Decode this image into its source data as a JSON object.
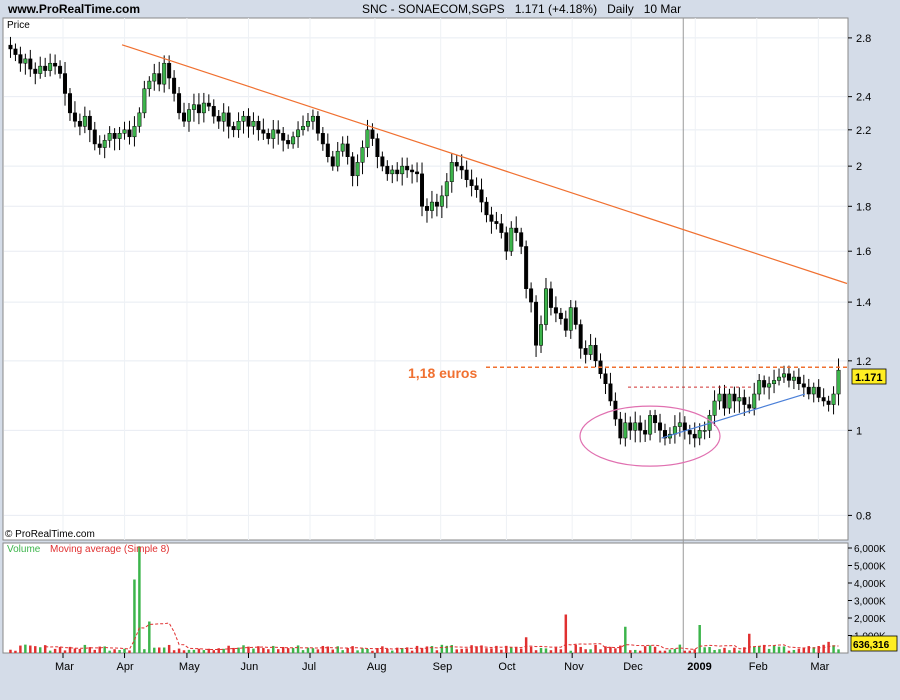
{
  "header": {
    "site": "www.ProRealTime.com",
    "symbol": "SNC - SONAECOM,SGPS",
    "last": "1.171 (+4.18%)",
    "period": "Daily",
    "date": "10 Mar"
  },
  "price_panel": {
    "label": "Price",
    "copyright": "© ProRealTime.com",
    "annotation": "1,18 euros",
    "last_price_tag": "1.171"
  },
  "volume_panel": {
    "label_volume": "Volume",
    "label_ma": "Moving average (Simple 8)",
    "last_volume_tag": "636,316"
  },
  "colors": {
    "background": "#d4dce8",
    "plot": "#ffffff",
    "up_candle": "#3cb44b",
    "down_candle": "#000000",
    "trendline_down": "#f07030",
    "trendline_up": "#4a7fd8",
    "resistance": "#f07030",
    "ellipse": "#e070b0",
    "volume_up": "#3cb44b",
    "volume_down": "#e03030",
    "volume_ma": "#e03030",
    "price_tag": "#ffee22"
  },
  "chart_data": [
    {
      "type": "candlestick",
      "title": "SNC - SONAECOM,SGPS",
      "scale": "log",
      "ylim": [
        0.75,
        2.95
      ],
      "y_ticks": [
        "0.8",
        "1",
        "1.2",
        "1.4",
        "1.6",
        "1.8",
        "2",
        "2.2",
        "2.4",
        "2.8"
      ],
      "x_ticks": [
        "Mar",
        "Apr",
        "May",
        "Jun",
        "Jul",
        "Aug",
        "Sep",
        "Oct",
        "Nov",
        "Dec",
        "2009",
        "Feb",
        "Mar"
      ],
      "closes": [
        2.72,
        2.68,
        2.62,
        2.65,
        2.58,
        2.55,
        2.6,
        2.57,
        2.62,
        2.6,
        2.55,
        2.42,
        2.3,
        2.25,
        2.22,
        2.28,
        2.2,
        2.12,
        2.1,
        2.14,
        2.18,
        2.15,
        2.18,
        2.2,
        2.16,
        2.22,
        2.3,
        2.45,
        2.5,
        2.55,
        2.48,
        2.62,
        2.52,
        2.42,
        2.3,
        2.25,
        2.32,
        2.35,
        2.3,
        2.36,
        2.34,
        2.28,
        2.25,
        2.3,
        2.22,
        2.2,
        2.25,
        2.28,
        2.22,
        2.25,
        2.2,
        2.18,
        2.15,
        2.2,
        2.18,
        2.14,
        2.12,
        2.16,
        2.2,
        2.22,
        2.25,
        2.28,
        2.18,
        2.12,
        2.05,
        2.0,
        2.08,
        2.12,
        2.05,
        1.95,
        2.02,
        2.1,
        2.2,
        2.15,
        2.05,
        2.0,
        1.96,
        1.98,
        1.96,
        2.0,
        1.98,
        1.97,
        1.96,
        1.8,
        1.78,
        1.82,
        1.8,
        1.85,
        1.92,
        2.02,
        2.0,
        1.98,
        1.93,
        1.9,
        1.88,
        1.82,
        1.76,
        1.73,
        1.72,
        1.68,
        1.6,
        1.7,
        1.68,
        1.62,
        1.45,
        1.4,
        1.25,
        1.32,
        1.45,
        1.38,
        1.36,
        1.34,
        1.3,
        1.38,
        1.32,
        1.24,
        1.22,
        1.25,
        1.2,
        1.16,
        1.13,
        1.08,
        1.03,
        0.98,
        1.02,
        1.0,
        1.02,
        1.0,
        0.99,
        1.04,
        1.02,
        1.0,
        0.98,
        0.99,
        1.01,
        1.02,
        1.0,
        0.99,
        0.98,
        1.0,
        1.0,
        1.04,
        1.08,
        1.1,
        1.06,
        1.1,
        1.08,
        1.09,
        1.07,
        1.06,
        1.1,
        1.14,
        1.12,
        1.13,
        1.14,
        1.15,
        1.16,
        1.14,
        1.15,
        1.13,
        1.12,
        1.1,
        1.12,
        1.09,
        1.08,
        1.07,
        1.1,
        1.171
      ],
      "resistance_level": 1.18,
      "trendline_down": {
        "from": [
          0.14,
          2.75
        ],
        "to": [
          1.0,
          1.47
        ]
      },
      "trendline_up": {
        "from": [
          0.78,
          0.98
        ],
        "to": [
          0.95,
          1.1
        ]
      }
    },
    {
      "type": "bar",
      "title": "Volume",
      "ylim": [
        0,
        6000000
      ],
      "y_ticks": [
        "1,000K",
        "2,000K",
        "3,000K",
        "4,000K",
        "5,000K",
        "6,000K"
      ],
      "ma_label": "Moving average (Simple 8)",
      "spikes": [
        {
          "pos": 0.148,
          "value": 4200000
        },
        {
          "pos": 0.158,
          "value": 6100000
        },
        {
          "pos": 0.166,
          "value": 1800000
        },
        {
          "pos": 0.62,
          "value": 900000
        },
        {
          "pos": 0.67,
          "value": 2200000
        },
        {
          "pos": 0.74,
          "value": 1500000
        },
        {
          "pos": 0.83,
          "value": 1600000
        },
        {
          "pos": 0.89,
          "value": 1100000
        },
        {
          "pos": 0.99,
          "value": 636316
        }
      ],
      "baseline_volume": 320000
    }
  ]
}
